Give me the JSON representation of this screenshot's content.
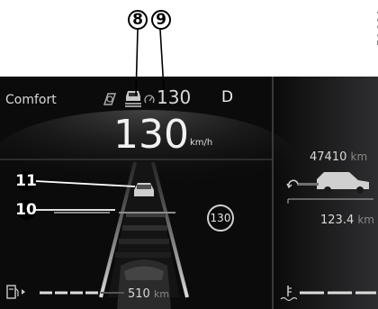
{
  "figure": {
    "reference_number": "59680"
  },
  "callouts": {
    "c8": "8",
    "c9": "9",
    "c10": "10",
    "c11": "11"
  },
  "header": {
    "drive_mode": "Comfort",
    "set_speed": "130",
    "gear": "D"
  },
  "speedometer": {
    "speed_value": "130",
    "speed_unit": "km/h"
  },
  "speed_limit_sign": {
    "value": "130"
  },
  "right_panel": {
    "odometer_value": "47410",
    "odometer_unit": "km",
    "trip_value": "123.4",
    "trip_unit": "km"
  },
  "footer": {
    "range_value": "510",
    "range_unit": "km"
  },
  "icons": {
    "hands_on_wheel": "steering-wheel-hand-icon",
    "vehicle_distance": "car-distance-icon",
    "speed_regulator": "speedometer-gauge-icon",
    "fuel": "fuel-pump-icon",
    "coolant": "coolant-temperature-icon",
    "trip_reset": "reset-arrow-icon"
  },
  "colors": {
    "background": "#0b0b0c",
    "text": "#d9d9d9",
    "page": "#ffffff"
  }
}
